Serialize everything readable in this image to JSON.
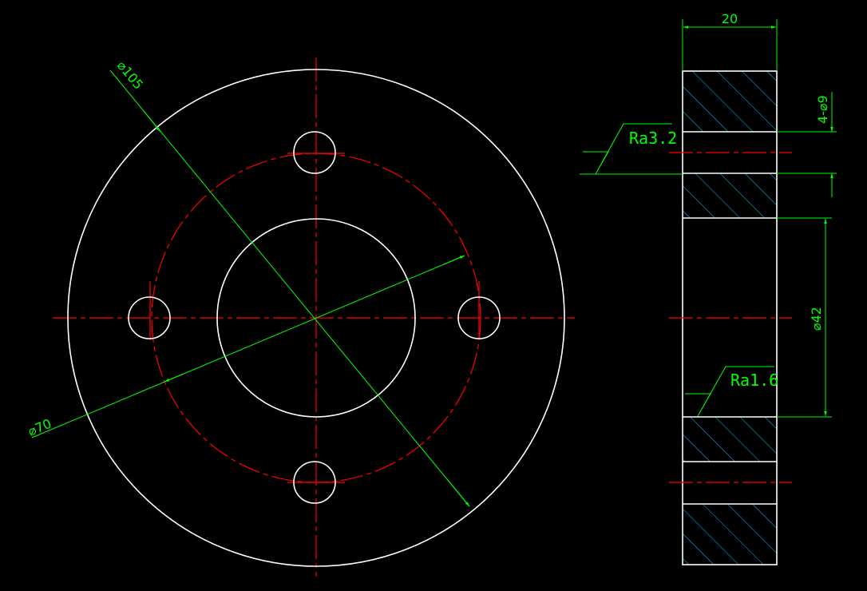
{
  "colors": {
    "background": "#000000",
    "outline": "#ffffff",
    "centerline": "#ff0000",
    "dimension": "#00ff00",
    "hatch": "#00c8ff"
  },
  "front_view": {
    "outer_diameter_label": "⌀105",
    "bolt_circle_label": "⌀70"
  },
  "side_view": {
    "thickness_label": "20",
    "hole_label": "4-⌀9",
    "bore_label": "⌀42",
    "roughness_top": "Ra3.2",
    "roughness_bottom": "Ra1.6"
  }
}
